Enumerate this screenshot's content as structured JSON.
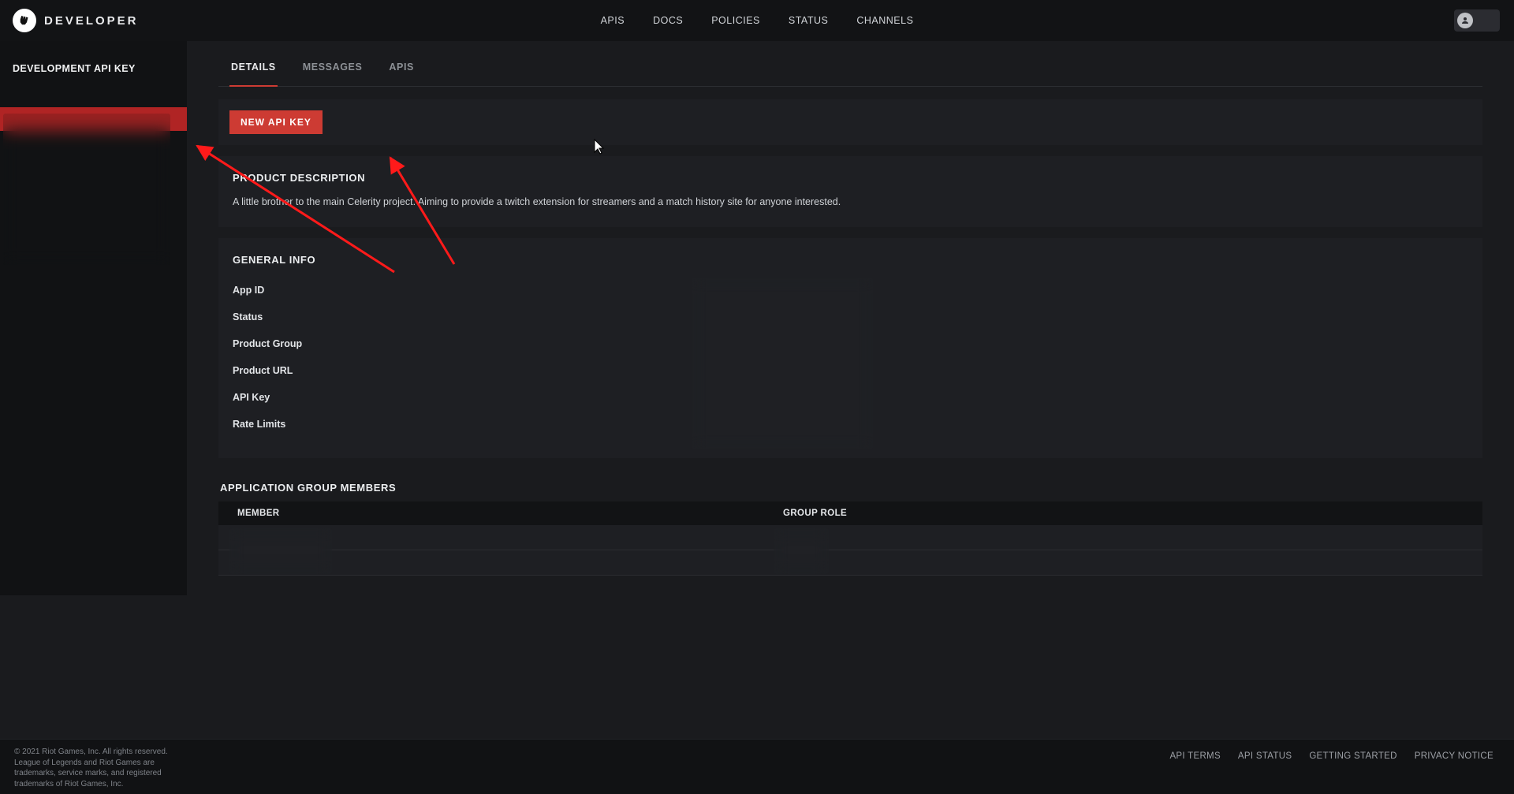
{
  "brand": "DEVELOPER",
  "top_nav": {
    "apis": "APIS",
    "docs": "DOCS",
    "policies": "POLICIES",
    "status": "STATUS",
    "channels": "CHANNELS"
  },
  "sidebar": {
    "heading": "DEVELOPMENT API KEY",
    "items": [
      "",
      "",
      "",
      "",
      ""
    ]
  },
  "tabs": {
    "details": "DETAILS",
    "messages": "MESSAGES",
    "apis": "APIS"
  },
  "buttons": {
    "new_api_key": "NEW API KEY"
  },
  "product": {
    "heading": "PRODUCT DESCRIPTION",
    "description": "A little brother to the main Celerity project. Aiming to provide a twitch extension for streamers and a match history site for anyone interested."
  },
  "general": {
    "heading": "GENERAL INFO",
    "labels": {
      "app_id": "App ID",
      "status": "Status",
      "product_group": "Product Group",
      "product_url": "Product URL",
      "api_key": "API Key",
      "rate_limits": "Rate Limits"
    },
    "values": {
      "app_id": "",
      "status": "",
      "product_group": "",
      "product_url": "",
      "api_key": "",
      "rate_limits": ""
    }
  },
  "members": {
    "heading": "APPLICATION GROUP MEMBERS",
    "columns": {
      "member": "MEMBER",
      "role": "GROUP ROLE"
    },
    "rows": [
      {
        "member": "",
        "role": ""
      },
      {
        "member": "",
        "role": ""
      }
    ]
  },
  "footer": {
    "copyright": "© 2021 Riot Games, Inc. All rights reserved. League of Legends and Riot Games are trademarks, service marks, and registered trademarks of Riot Games, Inc.",
    "links": {
      "terms": "API TERMS",
      "status": "API STATUS",
      "getting_started": "GETTING STARTED",
      "privacy": "PRIVACY NOTICE"
    }
  },
  "colors": {
    "accent": "#cd3b33",
    "bg": "#1a1b1e",
    "panel": "#1e1f23",
    "header": "#121315"
  }
}
